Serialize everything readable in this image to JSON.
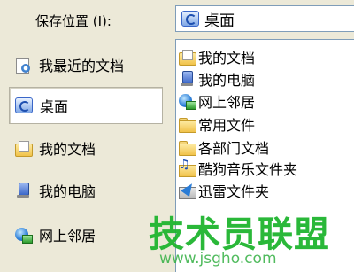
{
  "save_location": {
    "label": "保存位置 (I):",
    "current_value": "桌面",
    "current_icon": "desktop-icon"
  },
  "places_bar": [
    {
      "label": "我最近的文档",
      "icon": "recent-documents-icon",
      "selected": false
    },
    {
      "label": "桌面",
      "icon": "desktop-icon",
      "selected": true
    },
    {
      "label": "我的文档",
      "icon": "my-documents-icon",
      "selected": false
    },
    {
      "label": "我的电脑",
      "icon": "my-computer-icon",
      "selected": false
    },
    {
      "label": "网上邻居",
      "icon": "network-places-icon",
      "selected": false
    }
  ],
  "file_list": [
    {
      "label": "我的文档",
      "icon": "my-documents-icon"
    },
    {
      "label": "我的电脑",
      "icon": "my-computer-icon"
    },
    {
      "label": "网上邻居",
      "icon": "network-places-icon"
    },
    {
      "label": "常用文件",
      "icon": "folder-icon"
    },
    {
      "label": "各部门文档",
      "icon": "folder-icon"
    },
    {
      "label": "酷狗音乐文件夹",
      "icon": "music-folder-shortcut-icon"
    },
    {
      "label": "迅雷文件夹",
      "icon": "thunder-folder-shortcut-icon"
    }
  ],
  "watermark": {
    "title": "技术员联盟",
    "url": "www.jsgho.com",
    "color": "#1fb52f"
  }
}
